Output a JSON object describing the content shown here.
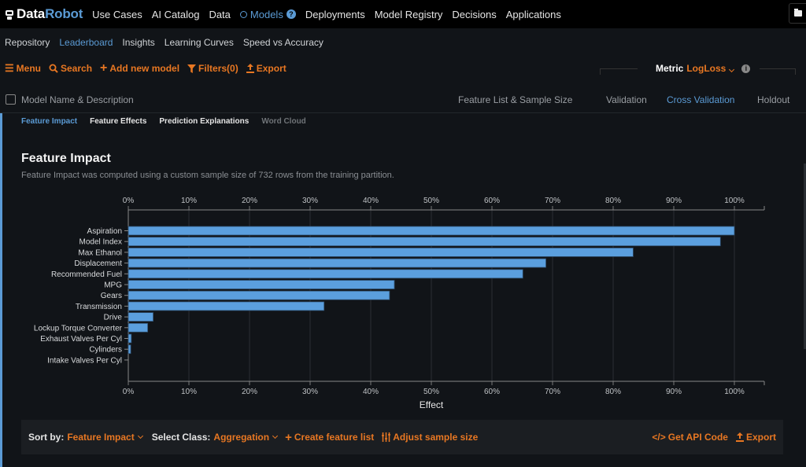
{
  "topnav": {
    "logo_primary": "Data",
    "logo_secondary": "Robot",
    "items": [
      {
        "label": "Use Cases"
      },
      {
        "label": "AI Catalog"
      },
      {
        "label": "Data"
      },
      {
        "label": "Models",
        "active": true,
        "badge": "?"
      },
      {
        "label": "Deployments"
      },
      {
        "label": "Model Registry"
      },
      {
        "label": "Decisions"
      },
      {
        "label": "Applications"
      }
    ]
  },
  "subnav": {
    "items": [
      {
        "label": "Repository"
      },
      {
        "label": "Leaderboard",
        "active": true
      },
      {
        "label": "Insights"
      },
      {
        "label": "Learning Curves"
      },
      {
        "label": "Speed vs Accuracy"
      }
    ]
  },
  "toolbar": {
    "menu": "Menu",
    "search": "Search",
    "add_model": "Add new model",
    "filters": "Filters(0)",
    "export": "Export",
    "metric_label": "Metric",
    "metric_value": "LogLoss"
  },
  "columns": {
    "model_name": "Model Name & Description",
    "feature_list": "Feature List & Sample Size",
    "validation": "Validation",
    "cross_validation": "Cross Validation",
    "holdout": "Holdout"
  },
  "insight_tabs": [
    {
      "label": "Feature Impact",
      "state": "active"
    },
    {
      "label": "Feature Effects",
      "state": "normal"
    },
    {
      "label": "Prediction Explanations",
      "state": "normal"
    },
    {
      "label": "Word Cloud",
      "state": "disabled"
    }
  ],
  "feature_impact": {
    "title": "Feature Impact",
    "description": "Feature Impact was computed using a custom sample size of 732 rows from the training partition."
  },
  "chart_data": {
    "type": "bar",
    "orientation": "horizontal",
    "title": "",
    "xlabel": "Effect",
    "ylabel": "",
    "xlim": [
      0,
      100
    ],
    "x_ticks": [
      "0%",
      "10%",
      "20%",
      "30%",
      "40%",
      "50%",
      "60%",
      "70%",
      "80%",
      "90%",
      "100%"
    ],
    "grid": true,
    "bar_color": "#5b9fde",
    "categories": [
      "Aspiration",
      "Model Index",
      "Max Ethanol",
      "Displacement",
      "Recommended Fuel",
      "MPG",
      "Gears",
      "Transmission",
      "Drive",
      "Lockup Torque Converter",
      "Exhaust Valves Per Cyl",
      "Cylinders",
      "Intake Valves Per Cyl"
    ],
    "values": [
      100,
      97.7,
      83.3,
      68.9,
      65.1,
      43.9,
      43.1,
      32.3,
      4.1,
      3.2,
      0.5,
      0.4,
      0
    ]
  },
  "bottom_bar": {
    "sort_label": "Sort by:",
    "sort_value": "Feature Impact",
    "class_label": "Select Class:",
    "class_value": "Aggregation",
    "create_list": "Create feature list",
    "adjust_sample": "Adjust sample size",
    "api_code": "Get API Code",
    "export": "Export"
  }
}
